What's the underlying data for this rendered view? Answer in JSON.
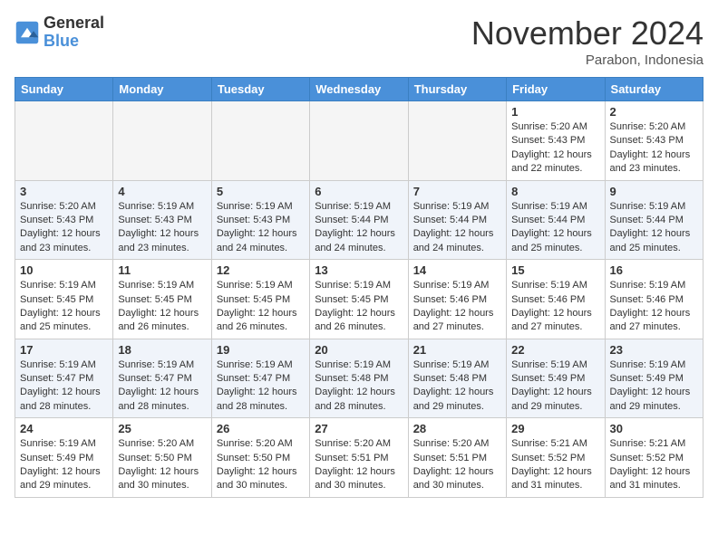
{
  "header": {
    "logo_line1": "General",
    "logo_line2": "Blue",
    "month": "November 2024",
    "location": "Parabon, Indonesia"
  },
  "weekdays": [
    "Sunday",
    "Monday",
    "Tuesday",
    "Wednesday",
    "Thursday",
    "Friday",
    "Saturday"
  ],
  "weeks": [
    [
      {
        "day": "",
        "empty": true
      },
      {
        "day": "",
        "empty": true
      },
      {
        "day": "",
        "empty": true
      },
      {
        "day": "",
        "empty": true
      },
      {
        "day": "",
        "empty": true
      },
      {
        "day": "1",
        "sunrise": "5:20 AM",
        "sunset": "5:43 PM",
        "daylight": "12 hours and 22 minutes."
      },
      {
        "day": "2",
        "sunrise": "5:20 AM",
        "sunset": "5:43 PM",
        "daylight": "12 hours and 23 minutes."
      }
    ],
    [
      {
        "day": "3",
        "sunrise": "5:20 AM",
        "sunset": "5:43 PM",
        "daylight": "12 hours and 23 minutes."
      },
      {
        "day": "4",
        "sunrise": "5:19 AM",
        "sunset": "5:43 PM",
        "daylight": "12 hours and 23 minutes."
      },
      {
        "day": "5",
        "sunrise": "5:19 AM",
        "sunset": "5:43 PM",
        "daylight": "12 hours and 24 minutes."
      },
      {
        "day": "6",
        "sunrise": "5:19 AM",
        "sunset": "5:44 PM",
        "daylight": "12 hours and 24 minutes."
      },
      {
        "day": "7",
        "sunrise": "5:19 AM",
        "sunset": "5:44 PM",
        "daylight": "12 hours and 24 minutes."
      },
      {
        "day": "8",
        "sunrise": "5:19 AM",
        "sunset": "5:44 PM",
        "daylight": "12 hours and 25 minutes."
      },
      {
        "day": "9",
        "sunrise": "5:19 AM",
        "sunset": "5:44 PM",
        "daylight": "12 hours and 25 minutes."
      }
    ],
    [
      {
        "day": "10",
        "sunrise": "5:19 AM",
        "sunset": "5:45 PM",
        "daylight": "12 hours and 25 minutes."
      },
      {
        "day": "11",
        "sunrise": "5:19 AM",
        "sunset": "5:45 PM",
        "daylight": "12 hours and 26 minutes."
      },
      {
        "day": "12",
        "sunrise": "5:19 AM",
        "sunset": "5:45 PM",
        "daylight": "12 hours and 26 minutes."
      },
      {
        "day": "13",
        "sunrise": "5:19 AM",
        "sunset": "5:45 PM",
        "daylight": "12 hours and 26 minutes."
      },
      {
        "day": "14",
        "sunrise": "5:19 AM",
        "sunset": "5:46 PM",
        "daylight": "12 hours and 27 minutes."
      },
      {
        "day": "15",
        "sunrise": "5:19 AM",
        "sunset": "5:46 PM",
        "daylight": "12 hours and 27 minutes."
      },
      {
        "day": "16",
        "sunrise": "5:19 AM",
        "sunset": "5:46 PM",
        "daylight": "12 hours and 27 minutes."
      }
    ],
    [
      {
        "day": "17",
        "sunrise": "5:19 AM",
        "sunset": "5:47 PM",
        "daylight": "12 hours and 28 minutes."
      },
      {
        "day": "18",
        "sunrise": "5:19 AM",
        "sunset": "5:47 PM",
        "daylight": "12 hours and 28 minutes."
      },
      {
        "day": "19",
        "sunrise": "5:19 AM",
        "sunset": "5:47 PM",
        "daylight": "12 hours and 28 minutes."
      },
      {
        "day": "20",
        "sunrise": "5:19 AM",
        "sunset": "5:48 PM",
        "daylight": "12 hours and 28 minutes."
      },
      {
        "day": "21",
        "sunrise": "5:19 AM",
        "sunset": "5:48 PM",
        "daylight": "12 hours and 29 minutes."
      },
      {
        "day": "22",
        "sunrise": "5:19 AM",
        "sunset": "5:49 PM",
        "daylight": "12 hours and 29 minutes."
      },
      {
        "day": "23",
        "sunrise": "5:19 AM",
        "sunset": "5:49 PM",
        "daylight": "12 hours and 29 minutes."
      }
    ],
    [
      {
        "day": "24",
        "sunrise": "5:19 AM",
        "sunset": "5:49 PM",
        "daylight": "12 hours and 29 minutes."
      },
      {
        "day": "25",
        "sunrise": "5:20 AM",
        "sunset": "5:50 PM",
        "daylight": "12 hours and 30 minutes."
      },
      {
        "day": "26",
        "sunrise": "5:20 AM",
        "sunset": "5:50 PM",
        "daylight": "12 hours and 30 minutes."
      },
      {
        "day": "27",
        "sunrise": "5:20 AM",
        "sunset": "5:51 PM",
        "daylight": "12 hours and 30 minutes."
      },
      {
        "day": "28",
        "sunrise": "5:20 AM",
        "sunset": "5:51 PM",
        "daylight": "12 hours and 30 minutes."
      },
      {
        "day": "29",
        "sunrise": "5:21 AM",
        "sunset": "5:52 PM",
        "daylight": "12 hours and 31 minutes."
      },
      {
        "day": "30",
        "sunrise": "5:21 AM",
        "sunset": "5:52 PM",
        "daylight": "12 hours and 31 minutes."
      }
    ]
  ],
  "labels": {
    "sunrise": "Sunrise:",
    "sunset": "Sunset:",
    "daylight": "Daylight:"
  }
}
